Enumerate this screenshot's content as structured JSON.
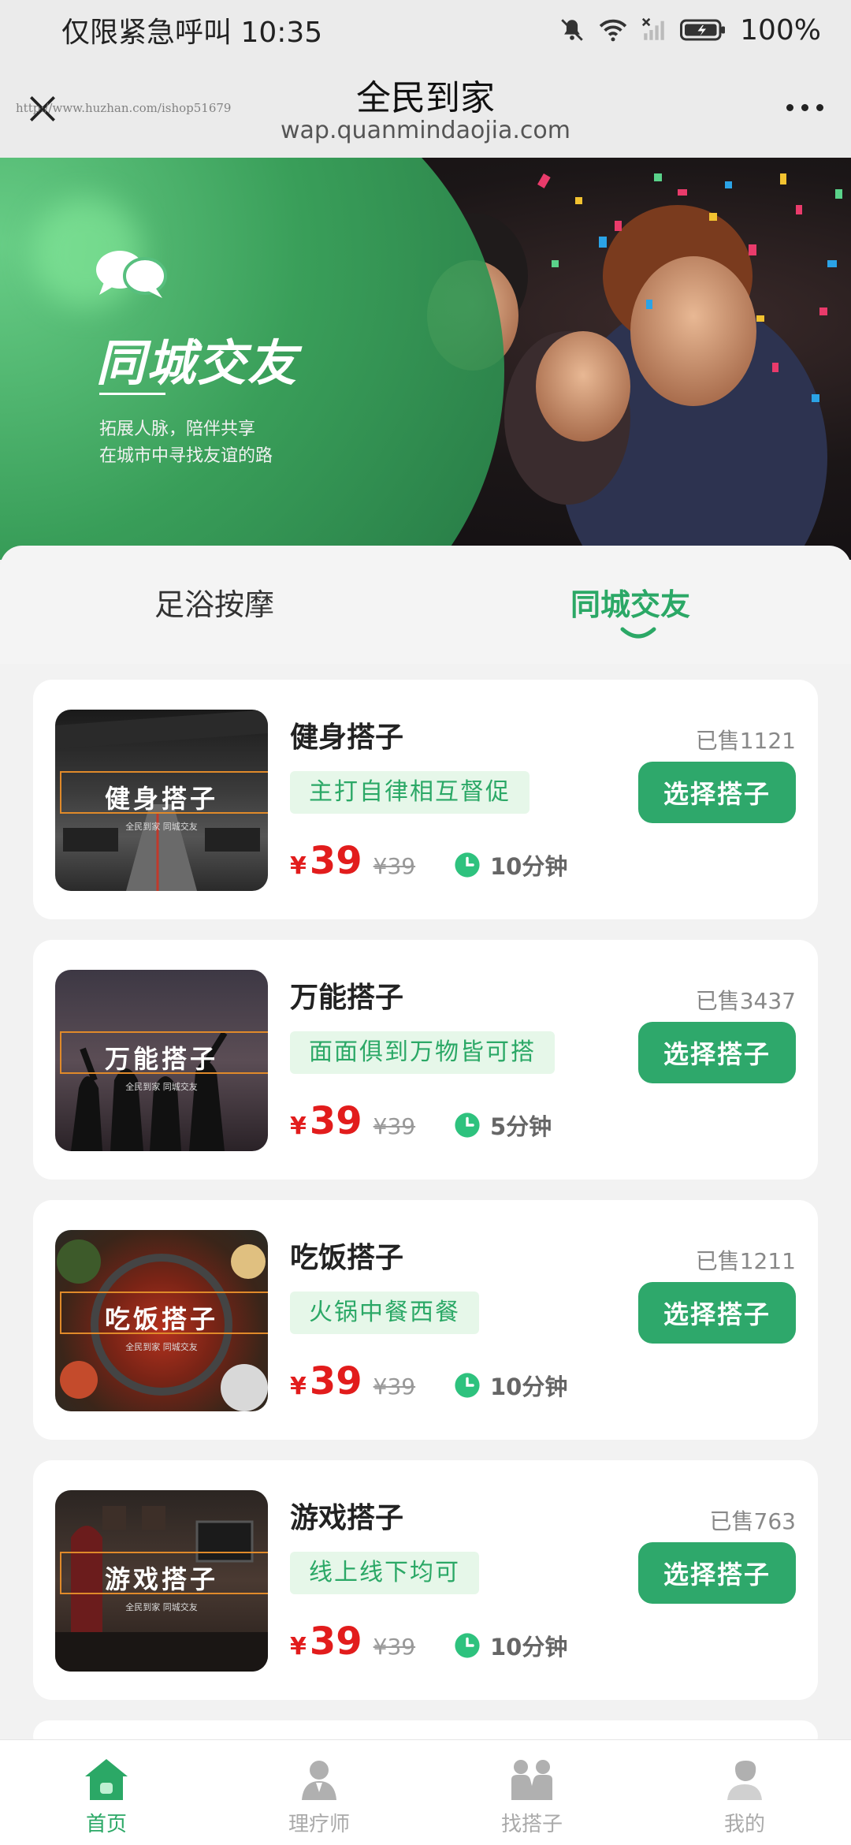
{
  "status_bar": {
    "left_text": "仅限紧急呼叫 10:35",
    "battery": "100%"
  },
  "title_bar": {
    "title": "全民到家",
    "url": "wap.quanmindaojia.com",
    "watermark": "http://www.huzhan.com/ishop51679"
  },
  "banner": {
    "title": "同城交友",
    "subtitle_line1": "拓展人脉，陪伴共享",
    "subtitle_line2": "在城市中寻找友谊的路"
  },
  "tabs": [
    {
      "label": "足浴按摩",
      "active": false
    },
    {
      "label": "同城交友",
      "active": true
    }
  ],
  "items": [
    {
      "thumb_text": "健身搭子",
      "thumb_sub": "全民到家 同城交友",
      "name": "健身搭子",
      "sold": "已售1121",
      "tag": "主打自律相互督促",
      "price_symbol": "¥",
      "price": "39",
      "old_price": "¥39",
      "duration": "10分钟",
      "button": "选择搭子"
    },
    {
      "thumb_text": "万能搭子",
      "thumb_sub": "全民到家 同城交友",
      "name": "万能搭子",
      "sold": "已售3437",
      "tag": "面面俱到万物皆可搭",
      "price_symbol": "¥",
      "price": "39",
      "old_price": "¥39",
      "duration": "5分钟",
      "button": "选择搭子"
    },
    {
      "thumb_text": "吃饭搭子",
      "thumb_sub": "全民到家 同城交友",
      "name": "吃饭搭子",
      "sold": "已售1211",
      "tag": "火锅中餐西餐",
      "price_symbol": "¥",
      "price": "39",
      "old_price": "¥39",
      "duration": "10分钟",
      "button": "选择搭子"
    },
    {
      "thumb_text": "游戏搭子",
      "thumb_sub": "全民到家 同城交友",
      "name": "游戏搭子",
      "sold": "已售763",
      "tag": "线上线下均可",
      "price_symbol": "¥",
      "price": "39",
      "old_price": "¥39",
      "duration": "10分钟",
      "button": "选择搭子"
    }
  ],
  "bottom_nav": [
    {
      "label": "首页",
      "icon": "home-icon",
      "active": true
    },
    {
      "label": "理疗师",
      "icon": "therapist-icon",
      "active": false
    },
    {
      "label": "找搭子",
      "icon": "find-partner-icon",
      "active": false
    },
    {
      "label": "我的",
      "icon": "profile-icon",
      "active": false
    }
  ],
  "colors": {
    "accent": "#2ba866",
    "price": "#e21c1c",
    "tag_bg": "#e6f7e9"
  }
}
